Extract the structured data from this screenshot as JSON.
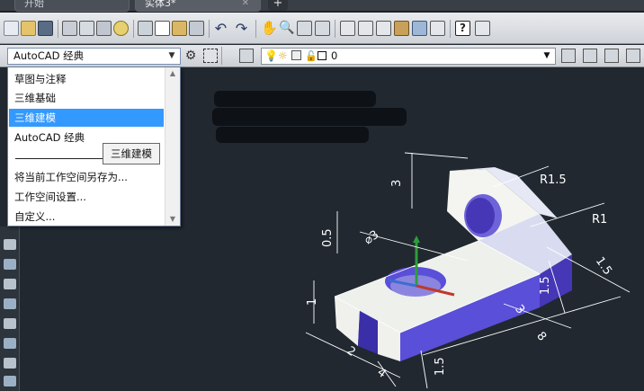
{
  "tabs": [
    {
      "label": "开始",
      "active": false
    },
    {
      "label": "实体3*",
      "active": true
    }
  ],
  "tab_add_label": "+",
  "toolbar": {
    "workspace_selected": "AutoCAD 经典",
    "layer_value": "0"
  },
  "workspace_dropdown": {
    "items": [
      {
        "label": "草图与注释",
        "selected": false
      },
      {
        "label": "三维基础",
        "selected": false
      },
      {
        "label": "三维建模",
        "selected": true
      },
      {
        "label": "AutoCAD 经典",
        "selected": false
      },
      {
        "label": "将当前工作空间另存为...",
        "selected": false
      },
      {
        "label": "工作空间设置...",
        "selected": false
      },
      {
        "label": "自定义...",
        "selected": false
      }
    ]
  },
  "tooltip": "三维建模",
  "dimensions": {
    "r_top": "R1.5",
    "r_side": "R1",
    "d_hole": "⌀3",
    "h_back": "3",
    "off_left": "0.5",
    "h_front": "1",
    "w_right": "1.5",
    "w_right2": "1.5",
    "len_mid": "3",
    "len_total": "8",
    "w_base": "2",
    "w_slot": "4",
    "h_slot": "1.5"
  },
  "icons": [
    "new-icon",
    "open-icon",
    "save-icon",
    "print-icon",
    "plot-preview-icon",
    "publish-icon",
    "undo-icon",
    "redo-icon",
    "pan-icon",
    "zoom-icon",
    "properties-icon",
    "help-icon",
    "gear-icon",
    "lightbulb-icon",
    "sun-icon",
    "lock-icon"
  ],
  "colors": {
    "selection": "#3399ff",
    "canvas": "#212830",
    "axis_x": "#c0392b",
    "axis_y": "#2e9e3a",
    "axis_z": "#3a6fd0"
  }
}
